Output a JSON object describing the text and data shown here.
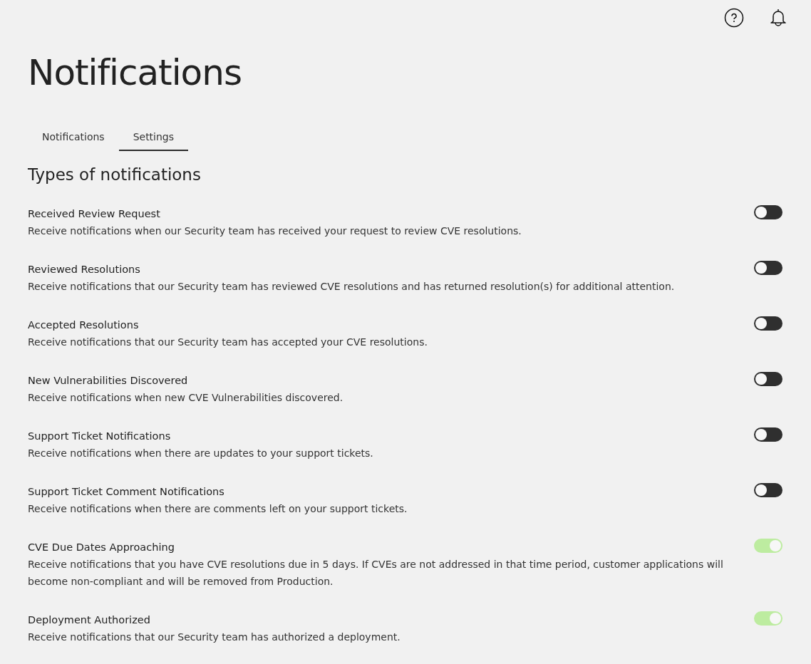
{
  "header": {
    "title": "Notifications"
  },
  "tabs": [
    {
      "label": "Notifications",
      "selected": false
    },
    {
      "label": "Settings",
      "selected": true
    }
  ],
  "section_title": "Types of notifications",
  "settings": [
    {
      "title": "Received Review Request",
      "description": "Receive notifications when our Security team has received your request to review CVE resolutions.",
      "on": false
    },
    {
      "title": "Reviewed Resolutions",
      "description": "Receive notifications that our Security team has reviewed CVE resolutions and has returned resolution(s) for additional attention.",
      "on": false
    },
    {
      "title": "Accepted Resolutions",
      "description": "Receive notifications that our Security team has accepted your CVE resolutions.",
      "on": false
    },
    {
      "title": "New Vulnerabilities Discovered",
      "description": "Receive notifications when new CVE Vulnerabilities discovered.",
      "on": false
    },
    {
      "title": "Support Ticket Notifications",
      "description": "Receive notifications when there are updates to your support tickets.",
      "on": false
    },
    {
      "title": "Support Ticket Comment Notifications",
      "description": "Receive notifications when there are comments left on your support tickets.",
      "on": false
    },
    {
      "title": "CVE Due Dates Approaching",
      "description": "Receive notifications that you have CVE resolutions due in 5 days. If CVEs are not addressed in that time period, customer applications will become non-compliant and will be removed from Production.",
      "on": true
    },
    {
      "title": "Deployment Authorized",
      "description": "Receive notifications that our Security team has authorized a deployment.",
      "on": true
    }
  ]
}
